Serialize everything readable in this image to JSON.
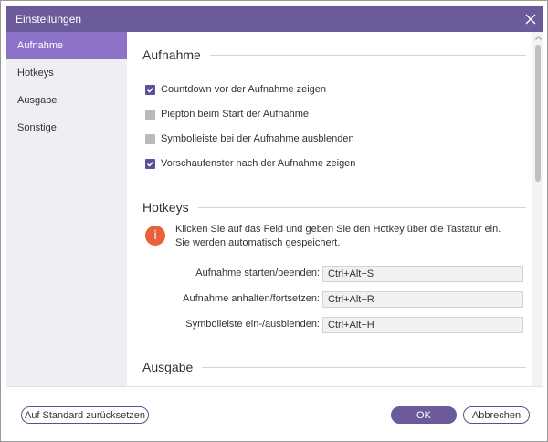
{
  "window": {
    "title": "Einstellungen"
  },
  "sidebar": {
    "items": [
      {
        "label": "Aufnahme",
        "active": true
      },
      {
        "label": "Hotkeys",
        "active": false
      },
      {
        "label": "Ausgabe",
        "active": false
      },
      {
        "label": "Sonstige",
        "active": false
      }
    ]
  },
  "sections": {
    "aufnahme": {
      "title": "Aufnahme",
      "options": [
        {
          "label": "Countdown vor der Aufnahme zeigen",
          "checked": true
        },
        {
          "label": "Piepton beim Start der Aufnahme",
          "checked": false
        },
        {
          "label": "Symbolleiste bei der Aufnahme ausblenden",
          "checked": false
        },
        {
          "label": "Vorschaufenster nach der Aufnahme zeigen",
          "checked": true
        }
      ]
    },
    "hotkeys": {
      "title": "Hotkeys",
      "info": "Klicken Sie auf das Feld und geben Sie den Hotkey über die Tastatur ein. Sie werden automatisch gespeichert.",
      "rows": [
        {
          "label": "Aufnahme starten/beenden:",
          "value": "Ctrl+Alt+S"
        },
        {
          "label": "Aufnahme anhalten/fortsetzen:",
          "value": "Ctrl+Alt+R"
        },
        {
          "label": "Symbolleiste ein-/ausblenden:",
          "value": "Ctrl+Alt+H"
        }
      ]
    },
    "ausgabe": {
      "title": "Ausgabe"
    }
  },
  "footer": {
    "reset_label": "Auf Standard zurücksetzen",
    "ok_label": "OK",
    "cancel_label": "Abbrechen"
  },
  "colors": {
    "titlebar": "#6b5b9a",
    "sidebar_active": "#8c73c7",
    "checkbox_checked": "#5d4f9a",
    "checkbox_unchecked": "#b9b9b9",
    "info_icon": "#e9613a"
  },
  "icons": {
    "close": "close-icon",
    "check": "checkmark-icon",
    "info": "info-icon",
    "scroll_up": "chevron-up-icon"
  }
}
